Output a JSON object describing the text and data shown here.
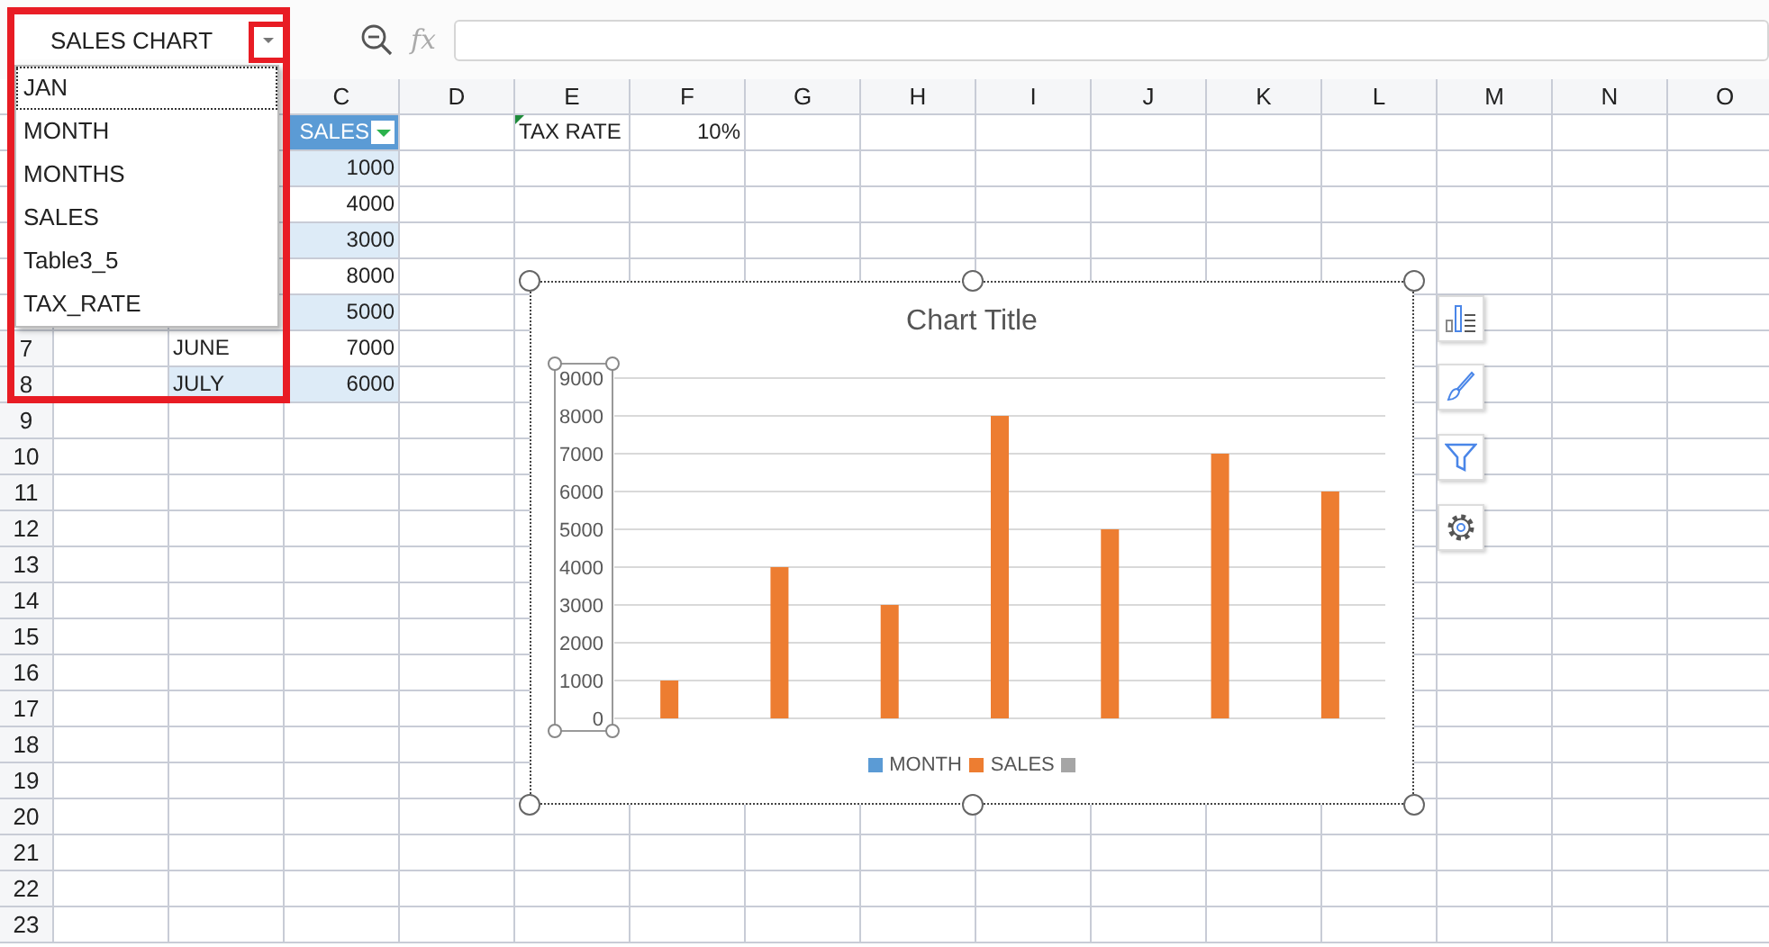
{
  "name_box": {
    "value": "SALES CHART"
  },
  "formula_bar": {
    "label": "fx"
  },
  "name_list": [
    {
      "label": "JAN",
      "selected": true
    },
    {
      "label": "MONTH",
      "selected": false
    },
    {
      "label": "MONTHS",
      "selected": false
    },
    {
      "label": "SALES",
      "selected": false
    },
    {
      "label": "Table3_5",
      "selected": false
    },
    {
      "label": "TAX_RATE",
      "selected": false
    }
  ],
  "sheet": {
    "column_headers": [
      "C",
      "D",
      "E",
      "F",
      "G",
      "H",
      "I",
      "J",
      "K",
      "L",
      "M",
      "N",
      "O"
    ],
    "rows": [
      {
        "column_c": {
          "text": "SALES",
          "kind": "table_header"
        },
        "column_e": {
          "text": "TAX RATE",
          "kind": "text"
        },
        "column_f": {
          "text": "10%",
          "kind": "number"
        }
      },
      {
        "banded": true,
        "column_c": {
          "text": "1000",
          "kind": "number"
        }
      },
      {
        "banded": false,
        "column_c": {
          "text": "4000",
          "kind": "number"
        }
      },
      {
        "banded": true,
        "column_c": {
          "text": "3000",
          "kind": "number"
        }
      },
      {
        "banded": false,
        "column_c": {
          "text": "8000",
          "kind": "number"
        }
      },
      {
        "banded": true,
        "column_c": {
          "text": "5000",
          "kind": "number"
        }
      },
      {
        "number": "7",
        "banded": false,
        "column_b": {
          "text": "JUNE",
          "kind": "text"
        },
        "column_c": {
          "text": "7000",
          "kind": "number"
        }
      },
      {
        "number": "8",
        "banded": true,
        "column_b": {
          "text": "JULY",
          "kind": "text"
        },
        "column_c": {
          "text": "6000",
          "kind": "number"
        }
      },
      {
        "number": "9"
      },
      {
        "number": "10"
      },
      {
        "number": "11"
      },
      {
        "number": "12"
      },
      {
        "number": "13"
      },
      {
        "number": "14"
      },
      {
        "number": "15"
      },
      {
        "number": "16"
      },
      {
        "number": "17"
      },
      {
        "number": "18"
      },
      {
        "number": "19"
      },
      {
        "number": "20"
      },
      {
        "number": "21"
      },
      {
        "number": "22"
      },
      {
        "number": "23"
      }
    ]
  },
  "chart": {
    "chart_data": {
      "type": "bar",
      "title": "Chart Title",
      "grid": true,
      "ylim": [
        0,
        9000
      ],
      "yticks": [
        {
          "value": 0,
          "label": "0"
        },
        {
          "value": 1000,
          "label": "1000"
        },
        {
          "value": 2000,
          "label": "2000"
        },
        {
          "value": 3000,
          "label": "3000"
        },
        {
          "value": 4000,
          "label": "4000"
        },
        {
          "value": 5000,
          "label": "5000"
        },
        {
          "value": 6000,
          "label": "6000"
        },
        {
          "value": 7000,
          "label": "7000"
        },
        {
          "value": 8000,
          "label": "8000"
        },
        {
          "value": 9000,
          "label": "9000"
        }
      ],
      "series": [
        {
          "name": "MONTH",
          "color": "#5b9bd5",
          "values": [
            null,
            null,
            null,
            null,
            null,
            null,
            null
          ]
        },
        {
          "name": "SALES",
          "color": "#ed7d31",
          "values": [
            1000,
            4000,
            3000,
            8000,
            5000,
            7000,
            6000
          ]
        },
        {
          "color": "#a5a5a5",
          "values": [
            null,
            null,
            null,
            null,
            null,
            null,
            null
          ]
        }
      ]
    }
  }
}
